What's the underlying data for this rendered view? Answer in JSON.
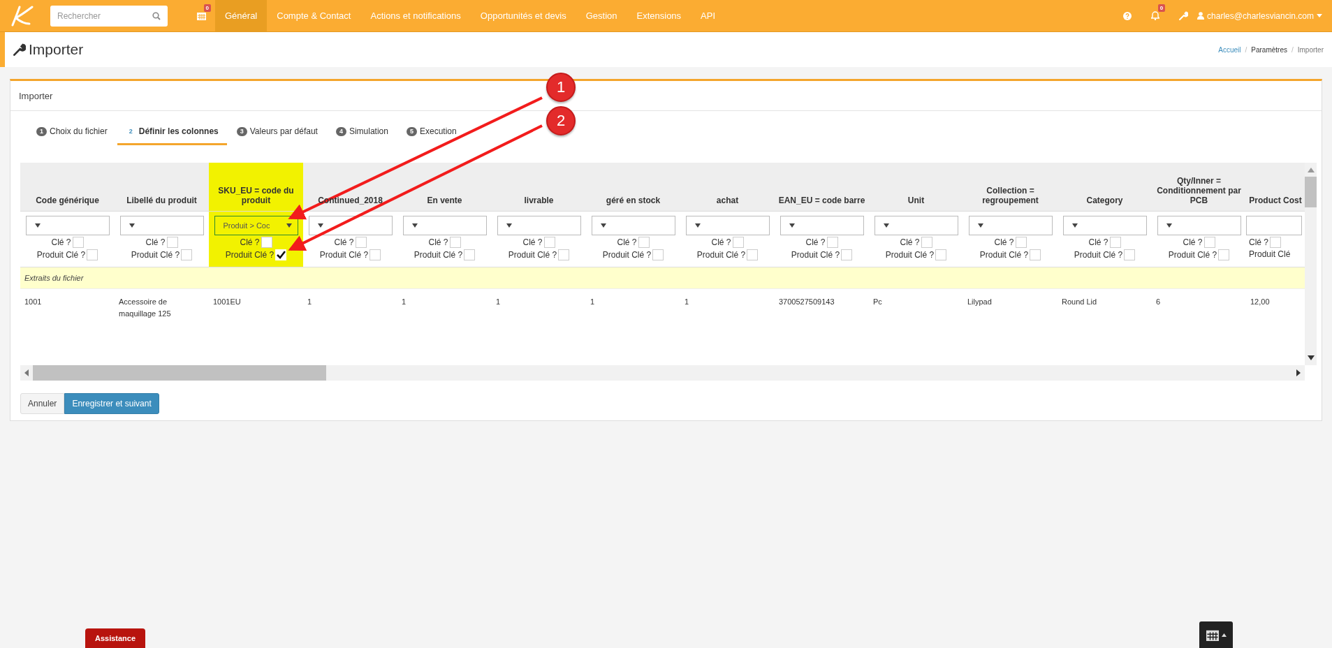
{
  "nav": {
    "search": {
      "placeholder": "Rechercher"
    },
    "calendar_badge": "0",
    "menu": [
      {
        "label": "Général",
        "selected": true
      },
      {
        "label": "Compte & Contact",
        "selected": false
      },
      {
        "label": "Actions et notifications",
        "selected": false
      },
      {
        "label": "Opportunités et devis",
        "selected": false
      },
      {
        "label": "Gestion",
        "selected": false
      },
      {
        "label": "Extensions",
        "selected": false
      },
      {
        "label": "API",
        "selected": false
      }
    ],
    "notifications_badge": "0",
    "user": "charles@charlesviancin.com"
  },
  "page": {
    "title": "Importer",
    "breadcrumb": [
      {
        "label": "Accueil"
      },
      {
        "separator": "/",
        "label": "Paramètres"
      },
      {
        "separator": "/",
        "label": "Importer"
      }
    ]
  },
  "panel": {
    "title": "Importer",
    "steps": [
      {
        "number": "1",
        "label": "Choix du fichier",
        "selected": false
      },
      {
        "number": "2",
        "label": "Définir les colonnes",
        "selected": true
      },
      {
        "number": "3",
        "label": "Valeurs par défaut",
        "selected": false
      },
      {
        "number": "4",
        "label": "Simulation",
        "selected": false
      },
      {
        "number": "5",
        "label": "Execution",
        "selected": false
      }
    ],
    "columns": [
      {
        "heading": "Code générique",
        "highlighted": false,
        "key_label": "Clé ?",
        "key": false,
        "product_key_label": "Produit Clé ?",
        "product_key": false
      },
      {
        "heading": "Libellé du produit",
        "highlighted": false,
        "key_label": "Clé ?",
        "key": false,
        "product_key_label": "Produit Clé ?",
        "product_key": false
      },
      {
        "heading": "SKU_EU = code du produit",
        "highlighted": true,
        "mapping": "Produit > Coc",
        "key_label": "Clé ?",
        "key": false,
        "product_key_label": "Produit Clé ?",
        "product_key": true
      },
      {
        "heading": "Continued_2018",
        "highlighted": false,
        "key_label": "Clé ?",
        "key": false,
        "product_key_label": "Produit Clé ?",
        "product_key": false
      },
      {
        "heading": "En vente",
        "highlighted": false,
        "key_label": "Clé ?",
        "key": false,
        "product_key_label": "Produit Clé ?",
        "product_key": false
      },
      {
        "heading": "livrable",
        "highlighted": false,
        "key_label": "Clé ?",
        "key": false,
        "product_key_label": "Produit Clé ?",
        "product_key": false
      },
      {
        "heading": "géré en stock",
        "highlighted": false,
        "key_label": "Clé ?",
        "key": false,
        "product_key_label": "Produit Clé ?",
        "product_key": false
      },
      {
        "heading": "achat",
        "highlighted": false,
        "key_label": "Clé ?",
        "key": false,
        "product_key_label": "Produit Clé ?",
        "product_key": false
      },
      {
        "heading": "EAN_EU = code barre",
        "highlighted": false,
        "key_label": "Clé ?",
        "key": false,
        "product_key_label": "Produit Clé ?",
        "product_key": false
      },
      {
        "heading": "Unit",
        "highlighted": false,
        "key_label": "Clé ?",
        "key": false,
        "product_key_label": "Produit Clé ?",
        "product_key": false
      },
      {
        "heading": "Collection = regroupement",
        "highlighted": false,
        "key_label": "Clé ?",
        "key": false,
        "product_key_label": "Produit Clé ?",
        "product_key": false
      },
      {
        "heading": "Category",
        "highlighted": false,
        "key_label": "Clé ?",
        "key": false,
        "product_key_label": "Produit Clé ?",
        "product_key": false
      },
      {
        "heading": "Qty/Inner = Conditionnement par PCB",
        "highlighted": false,
        "key_label": "Clé ?",
        "key": false,
        "product_key_label": "Produit Clé ?",
        "product_key": false
      },
      {
        "heading": "Product Cost",
        "highlighted": false,
        "key_label": "Clé ?",
        "key": false,
        "product_key_label": "Produit Clé"
      }
    ],
    "extract_label": "Extraits du fichier",
    "rows": [
      [
        "1001",
        "Accessoire de maquillage 125",
        "1001EU",
        "1",
        "1",
        "1",
        "1",
        "1",
        "3700527509143",
        "Pc",
        "Lilypad",
        "Round Lid",
        "6",
        "12,00"
      ]
    ],
    "buttons": [
      {
        "label": "Annuler",
        "kind": "default"
      },
      {
        "label": "Enregistrer et suivant",
        "kind": "primary"
      }
    ]
  },
  "assistance": "Assistance",
  "annotations": [
    {
      "label": "1"
    },
    {
      "label": "2"
    }
  ]
}
